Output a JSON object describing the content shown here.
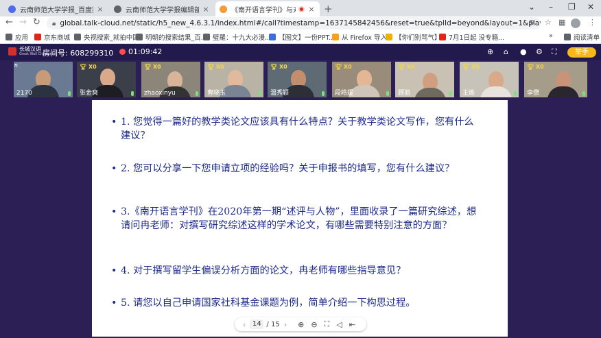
{
  "browser": {
    "tabs": [
      {
        "title": "云南师范大学学报_百度搜索",
        "favicon_color": "#4f6cf0",
        "active": false
      },
      {
        "title": "云南师范大学学报编辑部",
        "favicon_color": "#5f6368",
        "active": false
      },
      {
        "title": "《南开语言学刊》与对外汉",
        "favicon_color": "#f29d38",
        "active": true
      }
    ],
    "url": "global.talk-cloud.net/static/h5_new_4.6.3.1/index.html#/call?timestamp=1637145842456&reset=true&tplId=beyond&layout=1&playHostname=global.tal...",
    "bookmarks": [
      {
        "label": "应用",
        "icon_color": "#5f6368"
      },
      {
        "label": "京东商城",
        "icon_color": "#e1251b"
      },
      {
        "label": "央视搜索_就拍中国",
        "icon_color": "#5f6368"
      },
      {
        "label": "明朝的搜索结果_百...",
        "icon_color": "#5f6368"
      },
      {
        "label": "璧羅：十九大必漫...",
        "icon_color": "#5f6368"
      },
      {
        "label": "【图文】一份PPT...",
        "icon_color": "#3b6fd8"
      },
      {
        "label": "从 Firefox 导入",
        "icon_color": "#f4a31c"
      },
      {
        "label": "【你们别骂气】",
        "icon_color": "#e8b400"
      },
      {
        "label": "7月1日起 没专箱...",
        "icon_color": "#e1251b"
      }
    ],
    "reading_list": "阅读清单",
    "more_bookmarks": "»"
  },
  "classroom": {
    "room_label": "房间号: 608299310",
    "timer": "01:09:42",
    "raise_hand": "举手",
    "logo_text": "长城汉语",
    "logo_sub": "Great Wall Chinese"
  },
  "videos": [
    {
      "name": "2170",
      "badge": "",
      "wall": "#6b7a93",
      "skin": "#c99a78",
      "cloth": "#2b3340"
    },
    {
      "name": "张金爽",
      "badge": "X0",
      "wall": "#3a3f4a",
      "skin": "#d9a98a",
      "cloth": "#1d1d24"
    },
    {
      "name": "zhaoxinyu",
      "badge": "X0",
      "wall": "#8b8679",
      "skin": "#d7b49a",
      "cloth": "#333333"
    },
    {
      "name": "曹晓玉",
      "badge": "X0",
      "wall": "#b9b3a6",
      "skin": "#e1b99c",
      "cloth": "#7a8593"
    },
    {
      "name": "温秀颖",
      "badge": "X0",
      "wall": "#5e6b74",
      "skin": "#c48e6d",
      "cloth": "#2d2f36"
    },
    {
      "name": "段皓媛",
      "badge": "X0",
      "wall": "#9a8c7a",
      "skin": "#e3b796",
      "cloth": "#cfc5b8"
    },
    {
      "name": "顾丽",
      "badge": "X0",
      "wall": "#c9c2b4",
      "skin": "#d19f7f",
      "cloth": "#6f6a5e"
    },
    {
      "name": "王炼",
      "badge": "X0",
      "wall": "#c8c3b8",
      "skin": "#d9a98a",
      "cloth": "#e7e3da"
    },
    {
      "name": "李懋",
      "badge": "X0",
      "wall": "#a59c8a",
      "skin": "#c9937a",
      "cloth": "#2a2630"
    }
  ],
  "slide": {
    "questions": [
      "1.  您觉得一篇好的教学类论文应该具有什么特点？关于教学类论文写作，您有什么建议？",
      "2.  您可以分享一下您申请立项的经验吗？关于申报书的填写，您有什么建议？",
      "3.《南开语言学刊》在2020年第一期“述评与人物”，里面收录了一篇研究综述，想请问冉老师：对撰写研究综述这样的学术论文，有哪些需要特别注意的方面？",
      "4.  对于撰写留学生偏误分析方面的论文，冉老师有哪些指导意见？",
      "5.  请您以自己申请国家社科基金课题为例，简单介绍一下构思过程。"
    ],
    "current_page": "14",
    "total_pages": "/ 15"
  }
}
